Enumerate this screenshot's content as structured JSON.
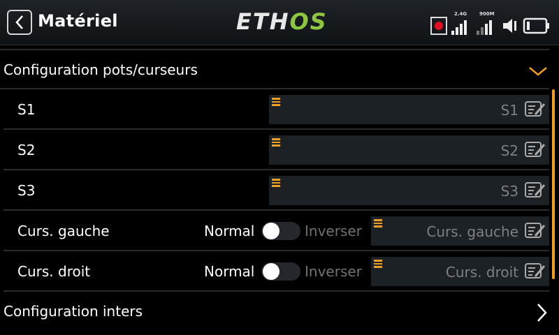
{
  "header": {
    "title": "Matériel",
    "logo_left": "ETH",
    "logo_right": "OS",
    "signal_24": "2.4G",
    "signal_900": "900M",
    "accent": "#f0a020",
    "logo_color": "#8dc63f"
  },
  "section_pots": {
    "title": "Configuration pots/curseurs",
    "icon": "chevron-down-icon"
  },
  "pots": [
    {
      "label": "S1",
      "value": "S1"
    },
    {
      "label": "S2",
      "value": "S2"
    },
    {
      "label": "S3",
      "value": "S3"
    }
  ],
  "sliders": [
    {
      "label": "Curs. gauche",
      "normal": "Normal",
      "inverse": "Inverser",
      "value": "Curs. gauche"
    },
    {
      "label": "Curs. droit",
      "normal": "Normal",
      "inverse": "Inverser",
      "value": "Curs. droit"
    }
  ],
  "section_switches": {
    "title": "Configuration inters",
    "icon": "chevron-right-icon"
  }
}
